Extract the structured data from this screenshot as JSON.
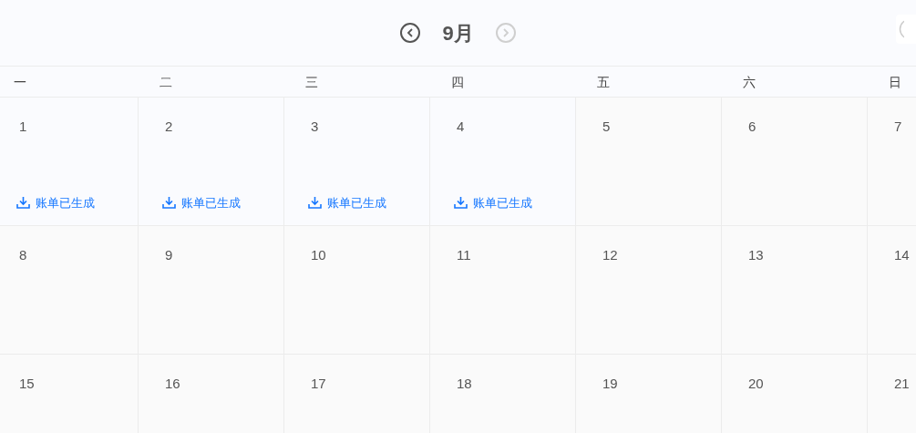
{
  "header": {
    "month": "9月",
    "prev_disabled": false,
    "next_disabled": true
  },
  "weekdays": [
    "一",
    "二",
    "三",
    "四",
    "五",
    "六",
    "日"
  ],
  "weeks": [
    [
      {
        "day": "1",
        "bill": "账单已生成"
      },
      {
        "day": "2",
        "bill": "账单已生成"
      },
      {
        "day": "3",
        "bill": "账单已生成"
      },
      {
        "day": "4",
        "bill": "账单已生成"
      },
      {
        "day": "5"
      },
      {
        "day": "6"
      },
      {
        "day": "7"
      }
    ],
    [
      {
        "day": "8"
      },
      {
        "day": "9"
      },
      {
        "day": "10"
      },
      {
        "day": "11"
      },
      {
        "day": "12"
      },
      {
        "day": "13"
      },
      {
        "day": "14"
      }
    ],
    [
      {
        "day": "15"
      },
      {
        "day": "16"
      },
      {
        "day": "17"
      },
      {
        "day": "18"
      },
      {
        "day": "19"
      },
      {
        "day": "20"
      },
      {
        "day": "21"
      }
    ]
  ]
}
